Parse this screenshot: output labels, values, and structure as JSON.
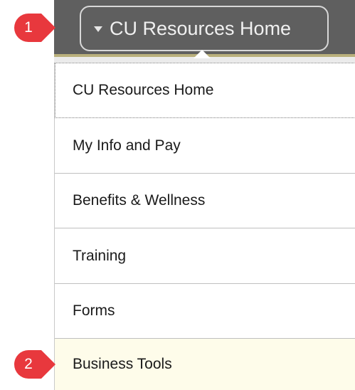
{
  "header": {
    "menu_label": "CU Resources Home"
  },
  "menu": {
    "items": [
      {
        "label": "CU Resources Home"
      },
      {
        "label": "My Info and Pay"
      },
      {
        "label": "Benefits & Wellness"
      },
      {
        "label": "Training"
      },
      {
        "label": "Forms"
      },
      {
        "label": "Business Tools"
      }
    ]
  },
  "callouts": [
    {
      "number": "1"
    },
    {
      "number": "2"
    }
  ],
  "colors": {
    "header_bg": "#5f5f5f",
    "callout_red": "#e8383d",
    "highlight_bg": "#fefcea"
  }
}
